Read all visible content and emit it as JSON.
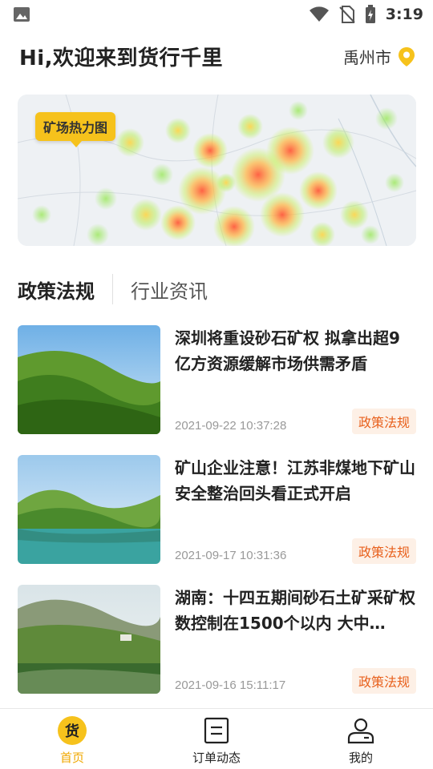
{
  "status_bar": {
    "time": "3:19"
  },
  "header": {
    "greeting": "Hi,欢迎来到货行千里",
    "city": "禹州市"
  },
  "map_banner": {
    "tag": "矿场热力图"
  },
  "tabs": [
    {
      "label": "政策法规",
      "active": true
    },
    {
      "label": "行业资讯",
      "active": false
    }
  ],
  "news": [
    {
      "title": "深圳将重设砂石矿权 拟拿出超9亿方资源缓解市场供需矛盾",
      "date": "2021-09-22 10:37:28",
      "category": "政策法规"
    },
    {
      "title": "矿山企业注意！江苏非煤地下矿山安全整治回头看正式开启",
      "date": "2021-09-17 10:31:36",
      "category": "政策法规"
    },
    {
      "title": "湖南：十四五期间砂石土矿采矿权数控制在1500个以内 大中…",
      "date": "2021-09-16 15:11:17",
      "category": "政策法规"
    }
  ],
  "bottom_nav": {
    "home": {
      "label": "首页",
      "icon_text": "货"
    },
    "orders": {
      "label": "订单动态"
    },
    "mine": {
      "label": "我的"
    }
  },
  "colors": {
    "accent": "#f6c21c",
    "badge_bg": "#fdf0e6",
    "badge_text": "#e8601c"
  }
}
